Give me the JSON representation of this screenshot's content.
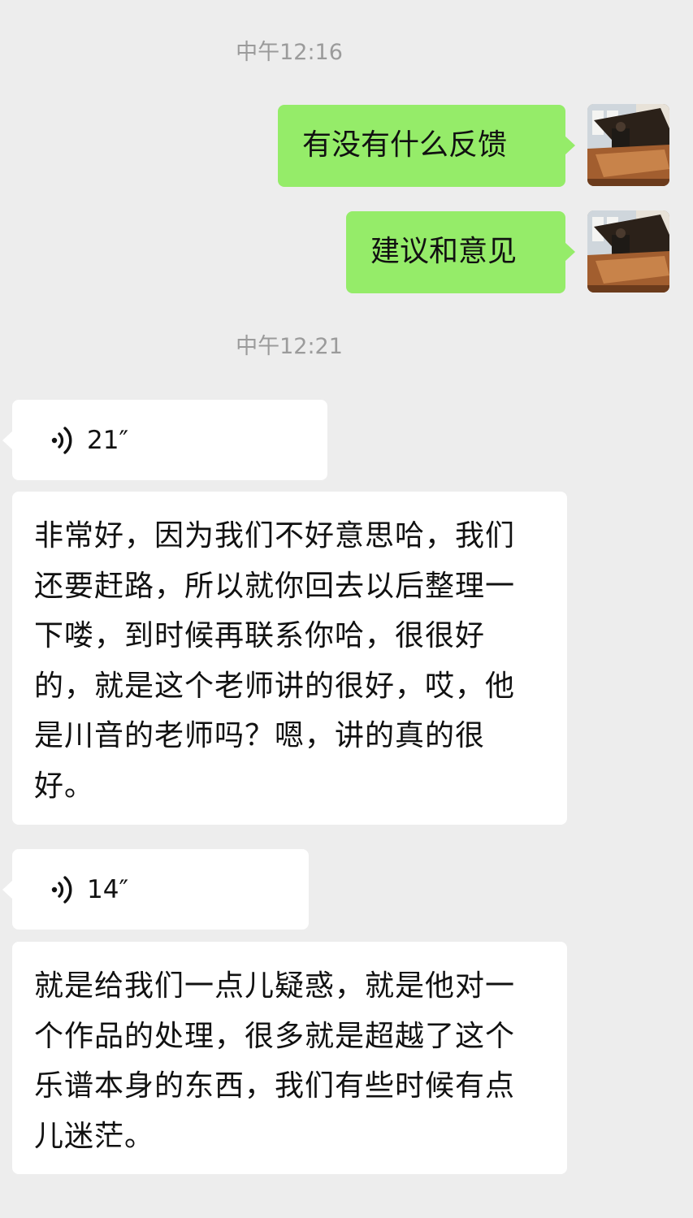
{
  "chat": {
    "timestamps": [
      "中午12:16",
      "中午12:21"
    ],
    "sent_messages": [
      {
        "text": "有没有什么反馈"
      },
      {
        "text": "建议和意见"
      }
    ],
    "voice_messages": [
      {
        "duration": "21″",
        "transcript": "非常好，因为我们不好意思哈，我们还要赶路，所以就你回去以后整理一下喽，到时候再联系你哈，很很好的，就是这个老师讲的很好，哎，他是川音的老师吗？嗯，讲的真的很好。"
      },
      {
        "duration": "14″",
        "transcript": "就是给我们一点儿疑惑，就是他对一个作品的处理，很多就是超越了这个乐谱本身的东西，我们有些时候有点儿迷茫。"
      }
    ]
  },
  "icons": {
    "voice": "voice-wave-icon",
    "avatar": "user-avatar-piano-photo"
  },
  "colors": {
    "background": "#ededed",
    "sent_bubble": "#95ec69",
    "received_bubble": "#ffffff",
    "timestamp_text": "#9b9b9b"
  }
}
